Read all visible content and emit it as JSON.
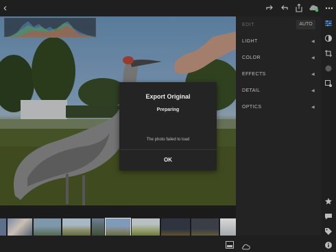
{
  "toolbar": {
    "back_icon": "back-chevron-icon",
    "icons": [
      "redo-icon",
      "undo-icon",
      "share-icon",
      "cloud-sync-icon",
      "more-icon"
    ]
  },
  "edit_panel": {
    "header_label": "EDIT",
    "auto_label": "AUTO",
    "sections": [
      {
        "label": "LIGHT"
      },
      {
        "label": "COLOR"
      },
      {
        "label": "EFFECTS"
      },
      {
        "label": "DETAIL"
      },
      {
        "label": "OPTICS"
      }
    ]
  },
  "right_rail_icons": [
    "sliders-icon",
    "presets-icon",
    "crop-icon",
    "selective-icon",
    "healing-icon",
    "star-icon",
    "comment-icon",
    "tag-icon",
    "info-icon"
  ],
  "filmstrip": {
    "thumbnail_count": 13,
    "selected_index": 5
  },
  "bottombar_icons": [
    "filmstrip-toggle-icon",
    "cloud-icon"
  ],
  "dialog": {
    "title": "Export Original",
    "status": "Preparing",
    "message": "The photo failed to load",
    "ok_label": "OK"
  },
  "colors": {
    "panel_bg": "#232323",
    "dialog_bg": "#242424",
    "accent_sync": "#3fbf5f"
  }
}
